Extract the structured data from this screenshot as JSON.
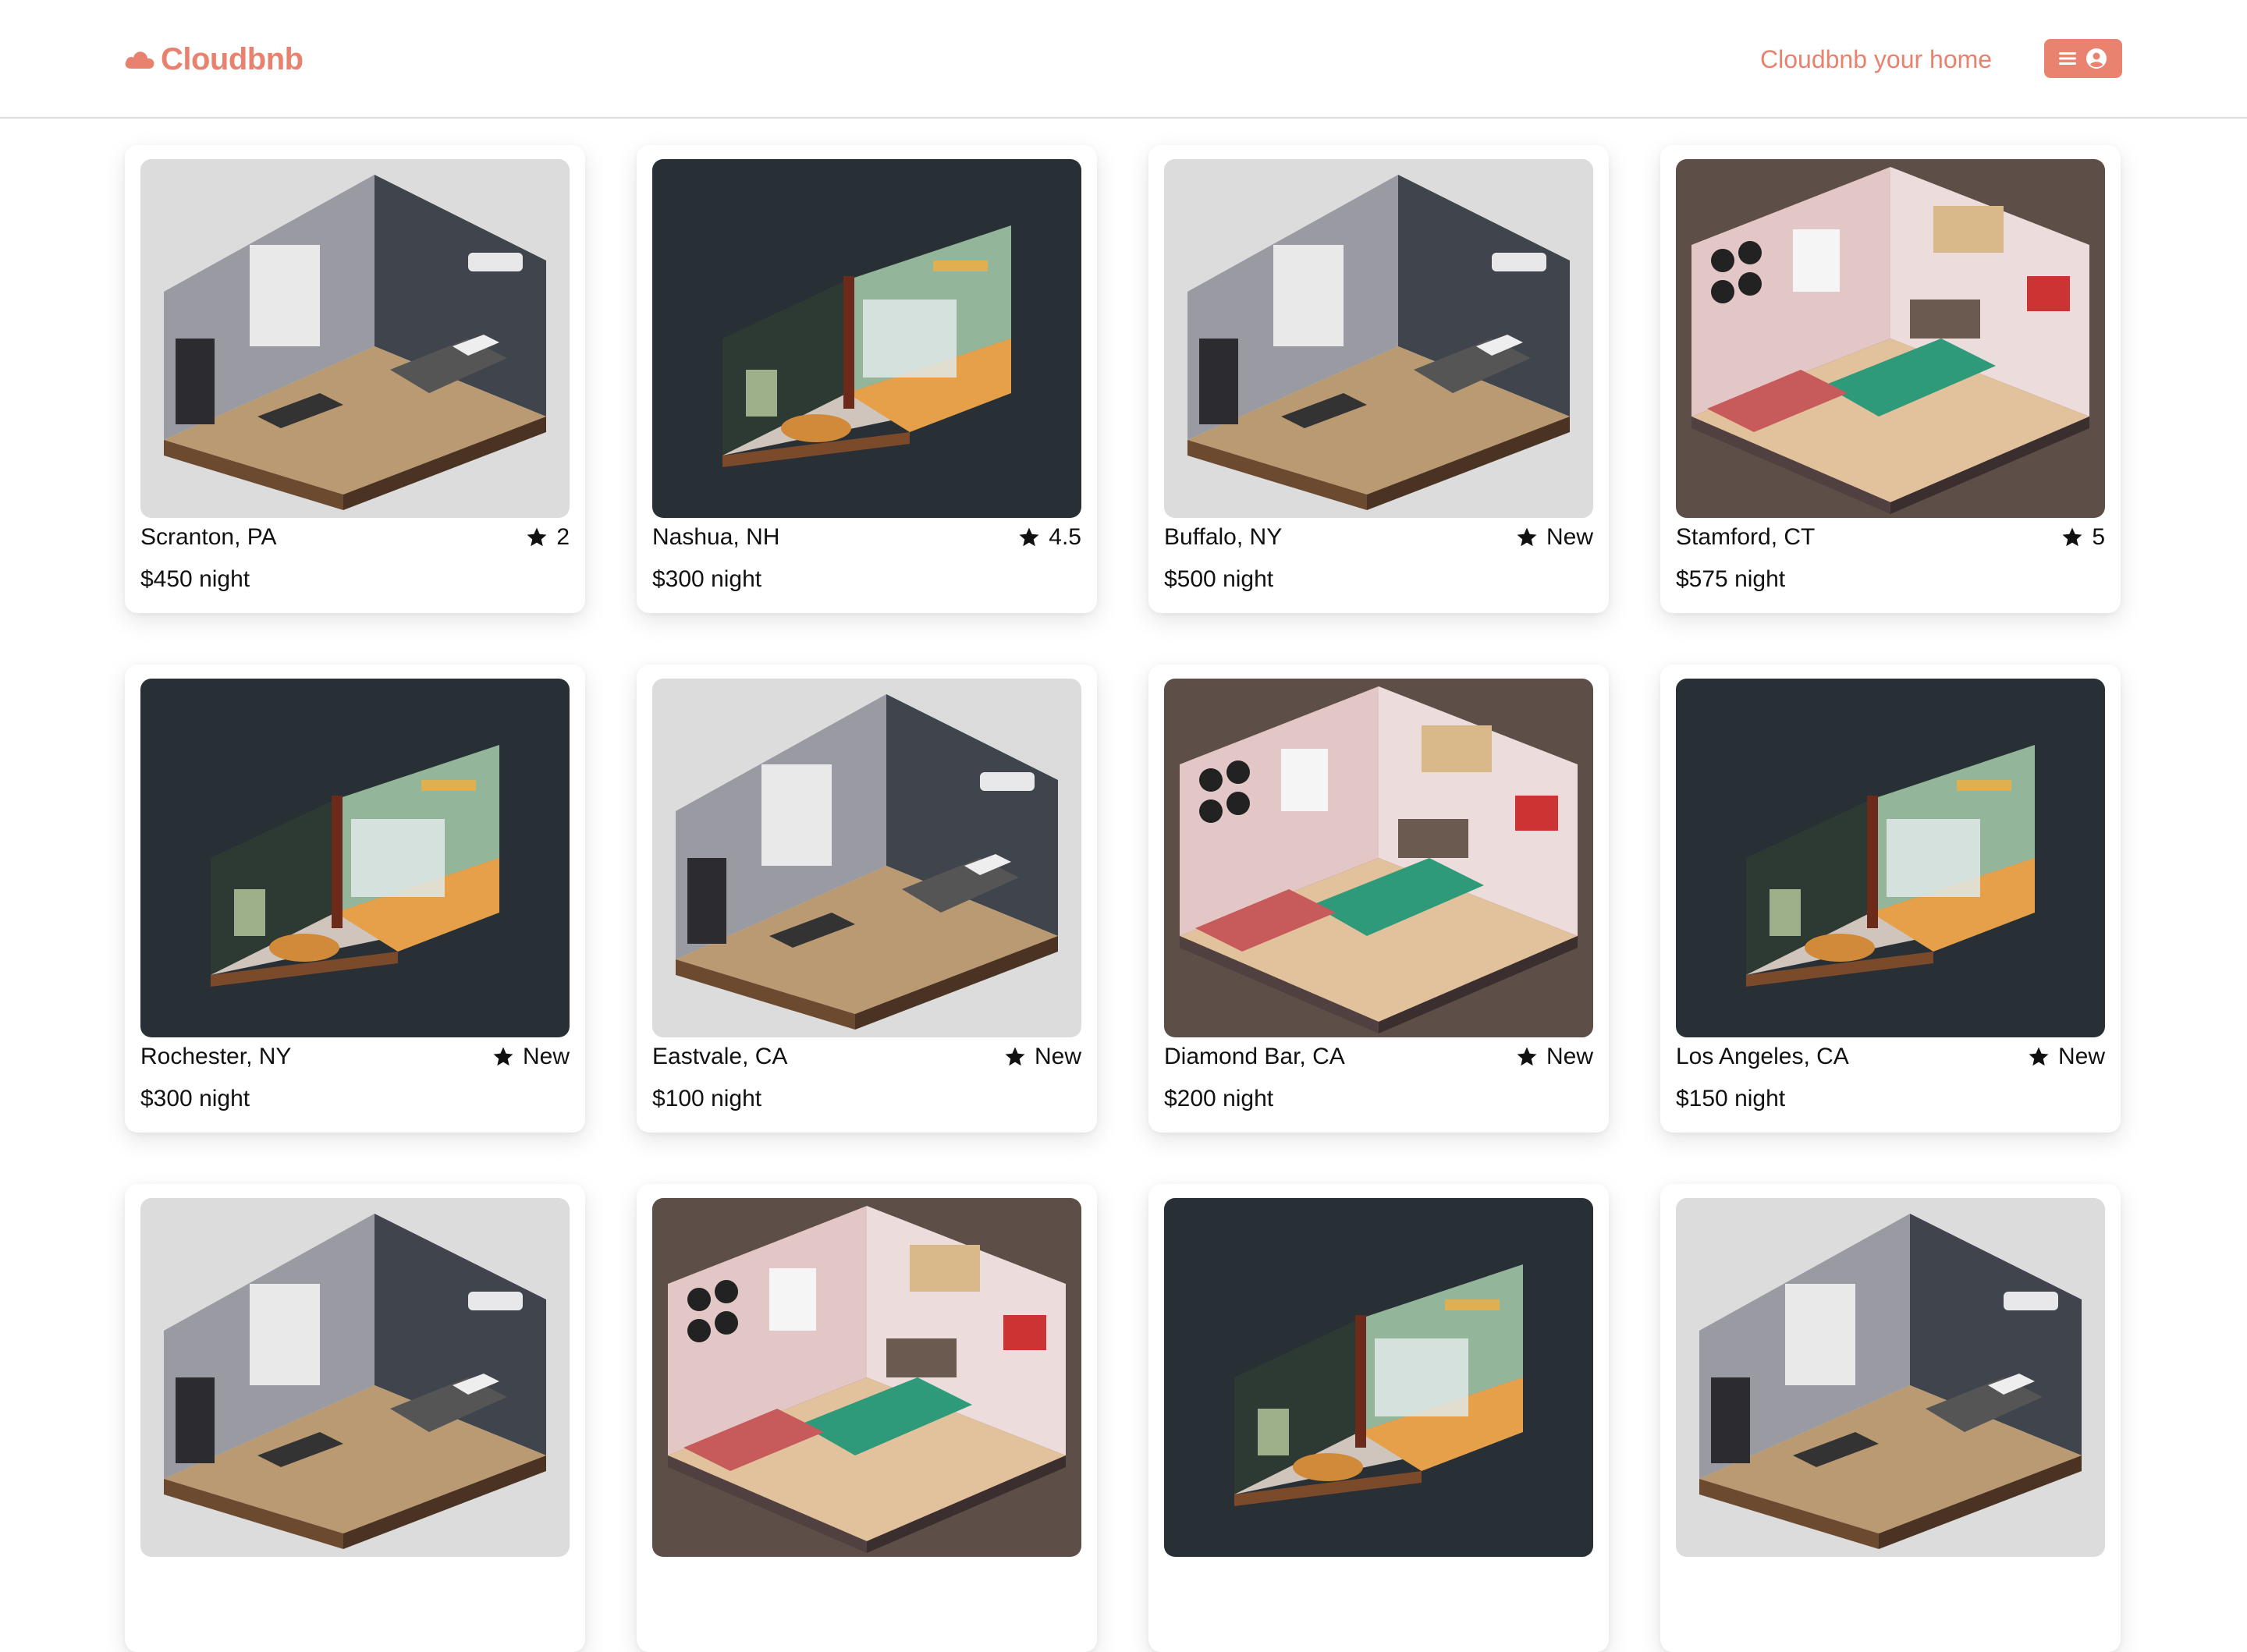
{
  "header": {
    "logo_text": "Cloudbnb",
    "host_link": "Cloudbnb your home",
    "accent_color": "#e8826f",
    "menu_icons": [
      "hamburger-icon",
      "user-circle-icon"
    ]
  },
  "listings": [
    {
      "location": "Scranton, PA",
      "rating": "2",
      "price": "$450 night",
      "room_style": "grey-modern"
    },
    {
      "location": "Nashua, NH",
      "rating": "4.5",
      "price": "$300 night",
      "room_style": "dark-green"
    },
    {
      "location": "Buffalo, NY",
      "rating": "New",
      "price": "$500 night",
      "room_style": "grey-modern"
    },
    {
      "location": "Stamford, CT",
      "rating": "5",
      "price": "$575 night",
      "room_style": "pink-cozy"
    },
    {
      "location": "Rochester, NY",
      "rating": "New",
      "price": "$300 night",
      "room_style": "dark-green"
    },
    {
      "location": "Eastvale, CA",
      "rating": "New",
      "price": "$100 night",
      "room_style": "grey-modern"
    },
    {
      "location": "Diamond Bar, CA",
      "rating": "New",
      "price": "$200 night",
      "room_style": "pink-cozy"
    },
    {
      "location": "Los Angeles, CA",
      "rating": "New",
      "price": "$150 night",
      "room_style": "dark-green"
    }
  ],
  "partial_row_styles": [
    "grey-modern",
    "pink-cozy",
    "dark-green",
    "grey-modern"
  ],
  "colors": {
    "grey-modern": "#dcdcdc",
    "dark-green": "#283036",
    "pink-cozy": "#5d4e47"
  }
}
